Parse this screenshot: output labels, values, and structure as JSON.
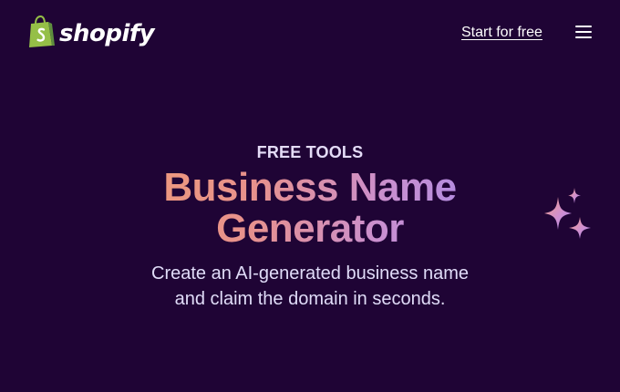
{
  "header": {
    "logo_text": "shopify",
    "cta_label": "Start for free",
    "menu_icon": "hamburger-menu-icon"
  },
  "hero": {
    "eyebrow": "FREE TOOLS",
    "title": "Business Name Generator",
    "subtitle": "Create an AI-generated business name and claim the domain in seconds.",
    "decoration_icon": "sparkles-icon"
  },
  "colors": {
    "background": "#1f0435",
    "logo_green": "#95bf47",
    "gradient_start": "#ef9a7a",
    "gradient_end": "#a88be8",
    "text_light": "#e0dcf8"
  }
}
